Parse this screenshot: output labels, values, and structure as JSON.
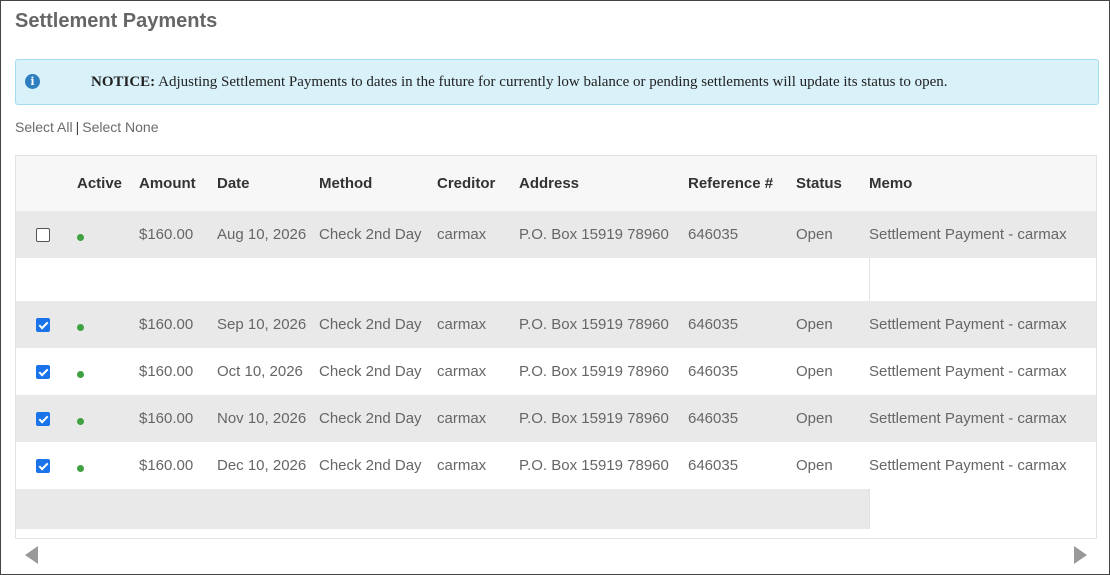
{
  "page": {
    "title": "Settlement Payments"
  },
  "notice": {
    "icon": "info-icon",
    "label": "NOTICE:",
    "text": " Adjusting Settlement Payments to dates in the future for currently low balance or pending settlements will update its status to open."
  },
  "select": {
    "all": "Select All",
    "separator": "|",
    "none": "Select None"
  },
  "table": {
    "columns": {
      "active": "Active",
      "amount": "Amount",
      "date": "Date",
      "method": "Method",
      "creditor": "Creditor",
      "address": "Address",
      "reference": "Reference #",
      "status": "Status",
      "memo": "Memo"
    },
    "rows": [
      {
        "checked": false,
        "amount": "$160.00",
        "date": "Aug 10, 2026",
        "method": "Check 2nd Day",
        "creditor": "carmax",
        "address": "P.O. Box 15919 78960",
        "reference": "646035",
        "status": "Open",
        "memo": "Settlement Payment - carmax"
      },
      {
        "checked": true,
        "amount": "$160.00",
        "date": "Sep 10, 2026",
        "method": "Check 2nd Day",
        "creditor": "carmax",
        "address": "P.O. Box 15919 78960",
        "reference": "646035",
        "status": "Open",
        "memo": "Settlement Payment - carmax"
      },
      {
        "checked": true,
        "amount": "$160.00",
        "date": "Oct 10, 2026",
        "method": "Check 2nd Day",
        "creditor": "carmax",
        "address": "P.O. Box 15919 78960",
        "reference": "646035",
        "status": "Open",
        "memo": "Settlement Payment - carmax"
      },
      {
        "checked": true,
        "amount": "$160.00",
        "date": "Nov 10, 2026",
        "method": "Check 2nd Day",
        "creditor": "carmax",
        "address": "P.O. Box 15919 78960",
        "reference": "646035",
        "status": "Open",
        "memo": "Settlement Payment - carmax"
      },
      {
        "checked": true,
        "amount": "$160.00",
        "date": "Dec 10, 2026",
        "method": "Check 2nd Day",
        "creditor": "carmax",
        "address": "P.O. Box 15919 78960",
        "reference": "646035",
        "status": "Open",
        "memo": "Settlement Payment - carmax"
      }
    ]
  },
  "colors": {
    "active_dot": "#3fa142",
    "checkbox": "#1a73e8",
    "notice_bg": "#d9f1f9"
  },
  "scroll": {
    "left_icon": "arrow-left-icon",
    "right_icon": "arrow-right-icon"
  }
}
